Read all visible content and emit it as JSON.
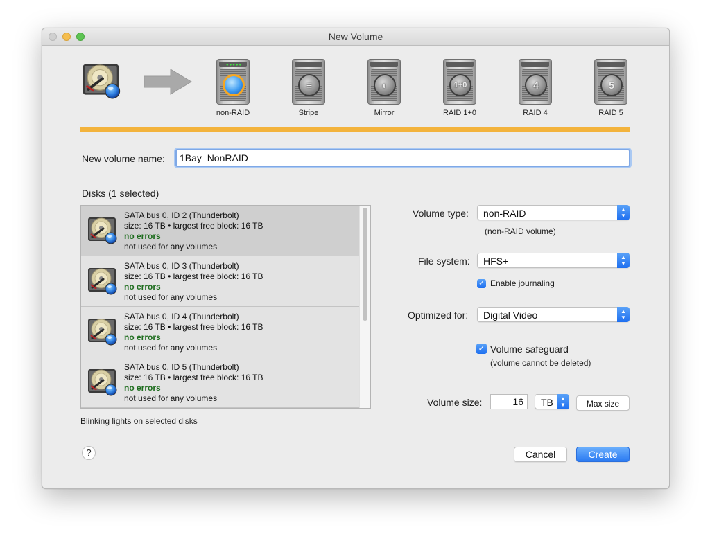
{
  "window": {
    "title": "New Volume"
  },
  "raid_types": [
    {
      "label": "non-RAID",
      "badge": "",
      "selected": true
    },
    {
      "label": "Stripe",
      "badge": "≡",
      "selected": false
    },
    {
      "label": "Mirror",
      "badge": "◐",
      "selected": false
    },
    {
      "label": "RAID 1+0",
      "badge": "1+0",
      "selected": false
    },
    {
      "label": "RAID 4",
      "badge": "4",
      "selected": false
    },
    {
      "label": "RAID 5",
      "badge": "5",
      "selected": false
    }
  ],
  "volume_name": {
    "label": "New volume name:",
    "value": "1Bay_NonRAID"
  },
  "disks": {
    "header": "Disks (1 selected)",
    "footer": "Blinking lights on selected disks",
    "items": [
      {
        "title": "SATA bus 0, ID 2 (Thunderbolt)",
        "size": "size: 16 TB • largest free block: 16 TB",
        "status": "no errors",
        "usage": "not used for any volumes",
        "selected": true
      },
      {
        "title": "SATA bus 0, ID 3 (Thunderbolt)",
        "size": "size: 16 TB • largest free block: 16 TB",
        "status": "no errors",
        "usage": "not used for any volumes",
        "selected": false
      },
      {
        "title": "SATA bus 0, ID 4 (Thunderbolt)",
        "size": "size: 16 TB • largest free block: 16 TB",
        "status": "no errors",
        "usage": "not used for any volumes",
        "selected": false
      },
      {
        "title": "SATA bus 0, ID 5 (Thunderbolt)",
        "size": "size: 16 TB • largest free block: 16 TB",
        "status": "no errors",
        "usage": "not used for any volumes",
        "selected": false
      }
    ]
  },
  "volume_type": {
    "label": "Volume type:",
    "value": "non-RAID",
    "note": "(non-RAID volume)"
  },
  "file_system": {
    "label": "File system:",
    "value": "HFS+",
    "journaling_label": "Enable journaling",
    "journaling": true
  },
  "optimized_for": {
    "label": "Optimized for:",
    "value": "Digital Video"
  },
  "safeguard": {
    "label": "Volume safeguard",
    "checked": true,
    "note": "(volume cannot be deleted)"
  },
  "volume_size": {
    "label": "Volume size:",
    "value": "16",
    "unit": "TB",
    "max_label": "Max size"
  },
  "buttons": {
    "help": "?",
    "cancel": "Cancel",
    "create": "Create"
  },
  "colors": {
    "accent": "#2a7af2",
    "progress": "#f3b33c",
    "ok_text": "#1e6d1e"
  },
  "icons": {
    "source_disk": "hard-disk-icon",
    "arrow": "right-arrow-icon",
    "raid_enclosure": "raid-enclosure-icon"
  }
}
